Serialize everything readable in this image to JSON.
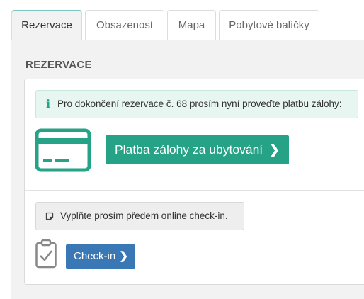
{
  "tabs": [
    {
      "label": "Rezervace",
      "active": true
    },
    {
      "label": "Obsazenost",
      "active": false
    },
    {
      "label": "Mapa",
      "active": false
    },
    {
      "label": "Pobytové balíčky",
      "active": false
    }
  ],
  "section": {
    "title": "REZERVACE"
  },
  "alert": {
    "icon": "info-icon",
    "text": "Pro dokončení rezervace č. 68 prosím nyní proveďte platbu zálohy:"
  },
  "payment": {
    "icon": "credit-card-icon",
    "button_label": "Platba zálohy za ubytování",
    "button_icon": "chevron-right-icon"
  },
  "checkin": {
    "notice_icon": "note-icon",
    "notice_text": "Vyplňte prosím předem online check-in.",
    "clipboard_icon": "clipboard-check-icon",
    "button_label": "Check-in",
    "button_icon": "chevron-right-icon"
  },
  "colors": {
    "accent_green": "#26a386",
    "button_blue": "#3a78b5",
    "alert_bg": "#e8f6f1",
    "panel_bg": "#f2f2f2"
  }
}
